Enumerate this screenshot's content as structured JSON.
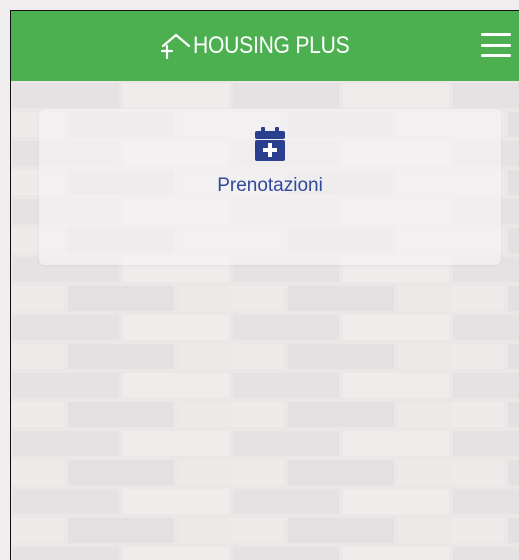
{
  "header": {
    "brand_name": "HOUSING PLUS",
    "menu_icon": "hamburger-menu-icon"
  },
  "main": {
    "tiles": [
      {
        "label": "Prenotazioni",
        "icon": "calendar-plus-icon"
      }
    ]
  },
  "colors": {
    "header_bg": "#4caf50",
    "tile_label": "#2f4a9a",
    "icon": "#2b3f8f"
  }
}
